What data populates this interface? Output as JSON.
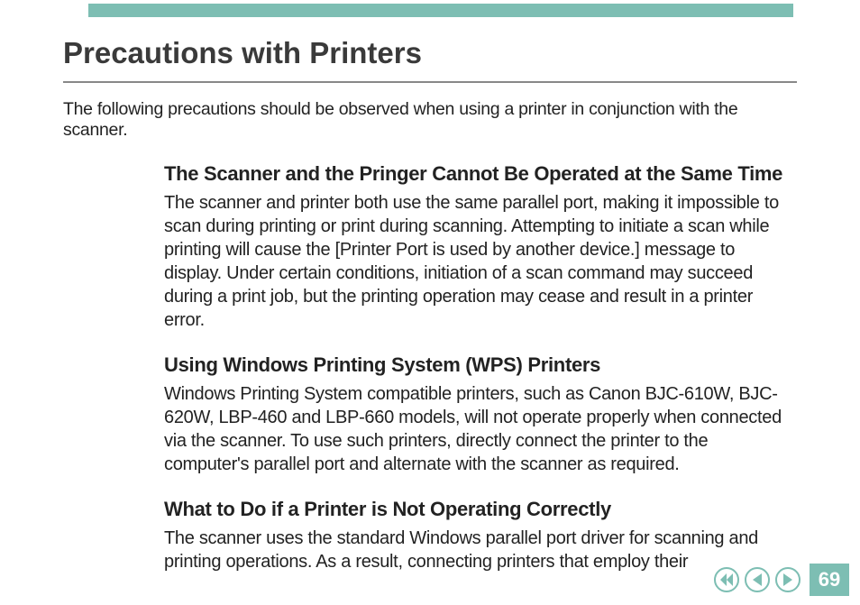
{
  "page": {
    "title": "Precautions with Printers",
    "intro": "The following precautions should be observed when using a printer in conjunction with the scanner.",
    "sections": [
      {
        "heading": "The Scanner and the Pringer Cannot Be Operated at the Same Time",
        "body": "The scanner and printer both use the same parallel port, making it impossible to scan during printing or print during scanning. Attempting to initiate a scan while printing will cause the [Printer Port is used by another device.] message to display. Under certain conditions, initiation of a scan command may succeed during a print job, but the printing operation may cease and result in a printer error."
      },
      {
        "heading": "Using Windows Printing System (WPS) Printers",
        "body": "Windows Printing System compatible printers, such as Canon BJC-610W, BJC-620W, LBP-460 and LBP-660 models, will not operate properly when connected via the scanner. To use such printers, directly connect the printer to the computer's parallel port and alternate with the scanner as required."
      },
      {
        "heading": "What to Do if a Printer is Not Operating Correctly",
        "body": "The scanner uses the standard Windows parallel port driver for scanning and printing operations. As a result, connecting printers that employ their"
      }
    ],
    "page_number": "69"
  },
  "colors": {
    "accent": "#7dbeb3"
  }
}
